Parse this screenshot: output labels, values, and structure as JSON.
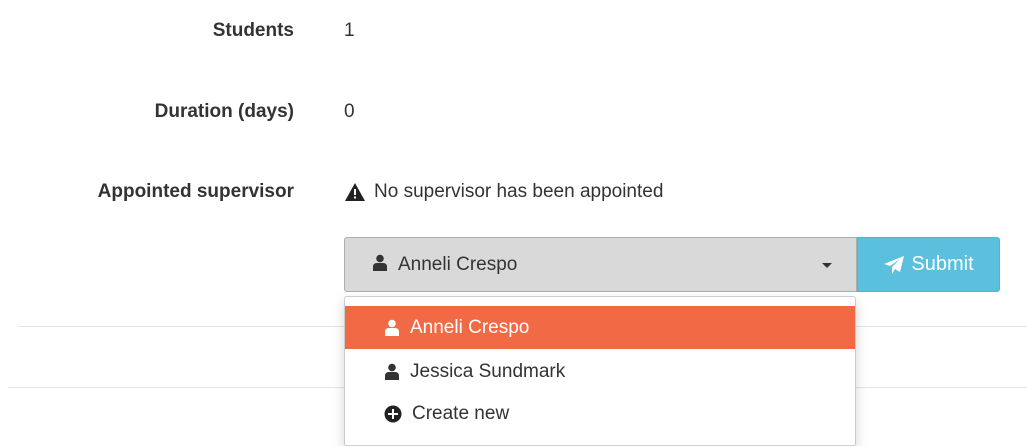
{
  "details": {
    "students_label": "Students",
    "students_value": "1",
    "duration_label": "Duration (days)",
    "duration_value": "0",
    "supervisor_label": "Appointed supervisor",
    "supervisor_status": "No supervisor has been appointed"
  },
  "supervisor_select": {
    "selected": "Anneli Crespo",
    "submit_label": "Submit",
    "options": [
      {
        "label": "Anneli Crespo",
        "icon": "user-icon",
        "active": true
      },
      {
        "label": "Jessica Sundmark",
        "icon": "user-icon",
        "active": false
      },
      {
        "label": "Create new",
        "icon": "plus-circle-icon",
        "active": false
      }
    ]
  },
  "colors": {
    "active_option": "#f26a45",
    "submit_button": "#5bc0de",
    "select_background": "#d9d9d9"
  }
}
